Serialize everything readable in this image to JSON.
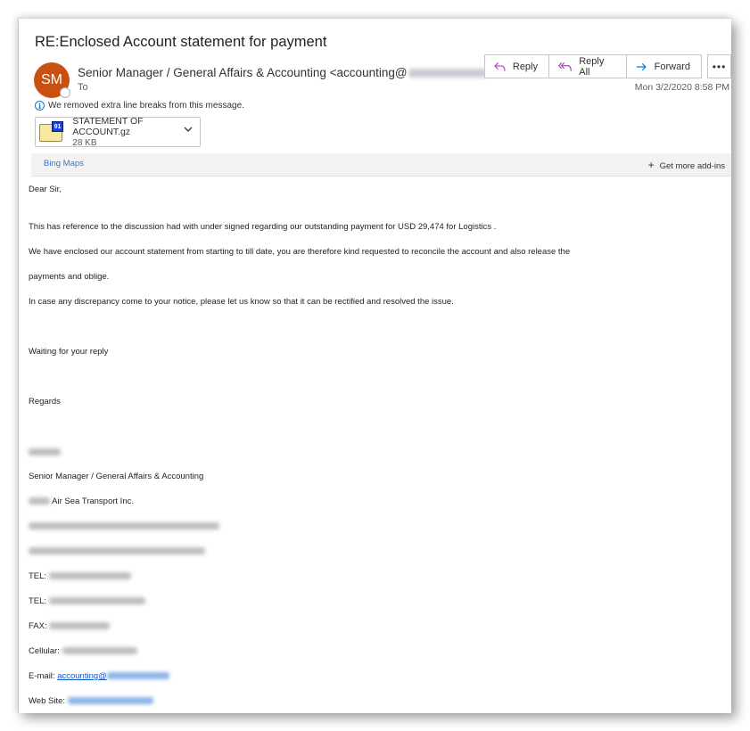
{
  "email": {
    "subject": "RE:Enclosed Account statement for payment",
    "sender": {
      "initials": "SM",
      "avatar_color": "#ca5010",
      "name_prefix": "Senior Manager / General Affairs & Accounting <accounting@",
      "name_suffix": ">",
      "to_label": "To"
    },
    "date": "Mon 3/2/2020 8:58 PM",
    "info_notice": "We removed extra line breaks from this message.",
    "attachment": {
      "name": "STATEMENT OF ACCOUNT.gz",
      "size": "28 KB"
    }
  },
  "actions": {
    "reply": "Reply",
    "reply_all": "Reply All",
    "forward": "Forward",
    "more": "•••"
  },
  "addins": {
    "bing_maps": "Bing Maps",
    "get_more": "Get more add-ins"
  },
  "body": {
    "greeting": "Dear Sir,",
    "p1": "This has reference to the discussion had with under signed regarding our outstanding payment for USD 29,474 for Logistics .",
    "p2": "We have enclosed our account statement from starting to till date, you are therefore kind requested to reconcile the account and also release the",
    "p3": "payments and oblige.",
    "p4": "In case any discrepancy come to your notice, please let us know so that it can be rectified and resolved the issue.",
    "p5": "Waiting for your reply",
    "regards": "Regards",
    "signature": {
      "title": "Senior Manager / General Affairs & Accounting",
      "company_suffix": "Air Sea Transport Inc.",
      "tel1_label": "TEL:",
      "tel2_label": "TEL:",
      "fax_label": "FAX:",
      "cellular_label": "Cellular:",
      "email_label": "E-mail:",
      "email_link_prefix": "accounting@",
      "website_label": "Web Site:"
    }
  },
  "colors": {
    "accent": "#0078d4",
    "link": "#2b7cd3",
    "reply_icon": "#b146c2"
  }
}
